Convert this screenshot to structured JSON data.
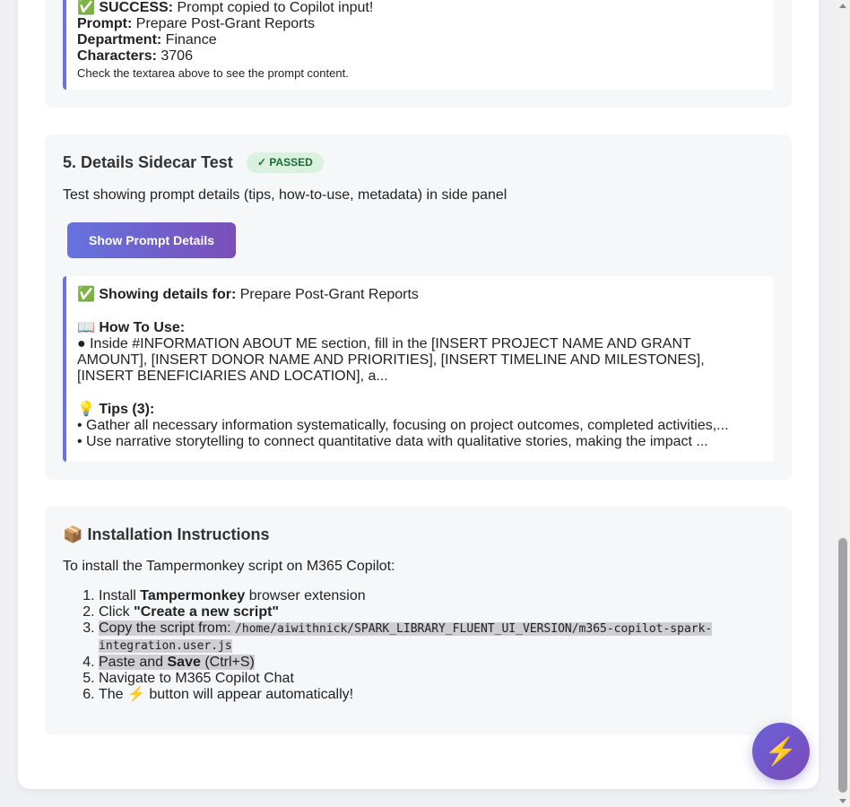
{
  "section4": {
    "success_icon": "✅",
    "success_label": "SUCCESS:",
    "success_text": " Prompt copied to Copilot input!",
    "prompt_label": "Prompt:",
    "prompt_value": " Prepare Post-Grant Reports",
    "department_label": "Department:",
    "department_value": " Finance",
    "characters_label": "Characters:",
    "characters_value": " 3706",
    "note": "Check the textarea above to see the prompt content."
  },
  "section5": {
    "title": "5. Details Sidecar Test",
    "badge": "✓ PASSED",
    "description": "Test showing prompt details (tips, how-to-use, metadata) in side panel",
    "button_label": "Show Prompt Details",
    "showing_icon": "✅",
    "showing_label": "Showing details for:",
    "showing_value": " Prepare Post-Grant Reports",
    "howto_icon": "📖",
    "howto_label": "How To Use:",
    "howto_text": "● Inside #INFORMATION ABOUT ME section, fill in the [INSERT PROJECT NAME AND GRANT AMOUNT], [INSERT DONOR NAME AND PRIORITIES], [INSERT TIMELINE AND MILESTONES], [INSERT BENEFICIARIES AND LOCATION], a...",
    "tips_icon": "💡",
    "tips_label": "Tips (3):",
    "tips": [
      "• Gather all necessary information systematically, focusing on project outcomes, completed activities,...",
      "• Use narrative storytelling to connect quantitative data with qualitative stories, making the impact ..."
    ]
  },
  "install": {
    "icon": "📦",
    "title": "Installation Instructions",
    "intro": "To install the Tampermonkey script on M365 Copilot:",
    "step1_pre": "Install ",
    "step1_bold": "Tampermonkey",
    "step1_post": " browser extension",
    "step2_pre": "Click ",
    "step2_bold": "\"Create a new script\"",
    "step3_pre": "Copy the script from: ",
    "step3_code": "/home/aiwithnick/SPARK_LIBRARY_FLUENT_UI_VERSION/m365-copilot-spark-integration.user.js",
    "step4_pre": "Paste and ",
    "step4_bold": "Save",
    "step4_post": " (Ctrl+S)",
    "step5": "Navigate to M365 Copilot Chat",
    "step6_pre": "The ",
    "step6_icon": "⚡",
    "step6_post": " button will appear automatically!"
  },
  "fab": {
    "icon": "⚡",
    "icon_name": "lightning-icon"
  }
}
